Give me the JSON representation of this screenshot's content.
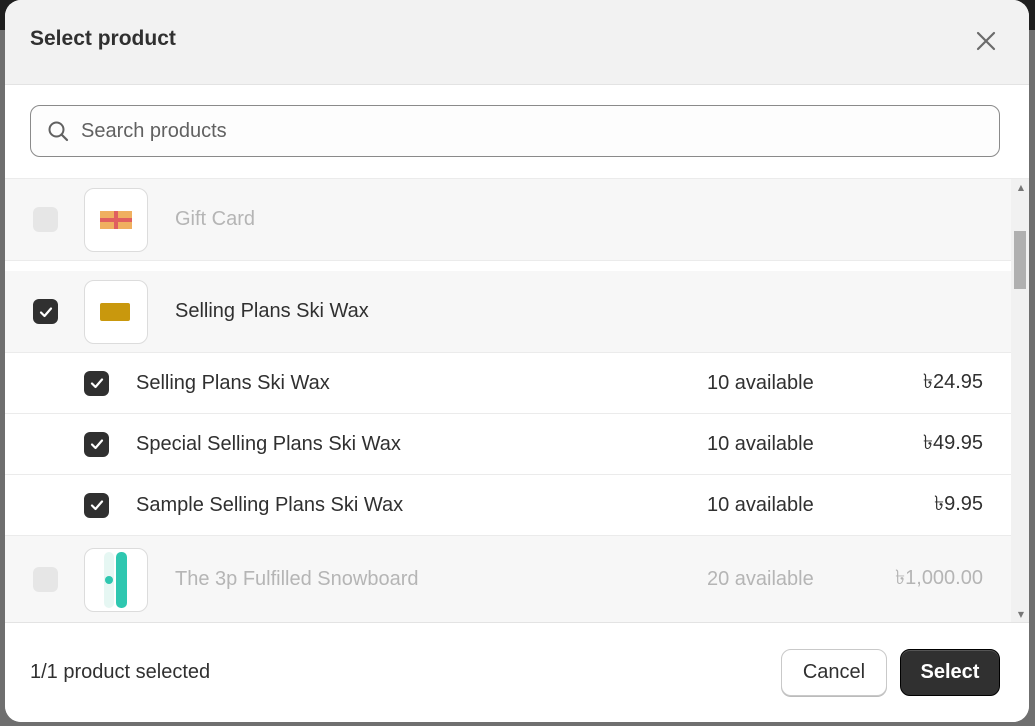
{
  "dialog": {
    "title": "Select product",
    "close_icon": "close-icon"
  },
  "search": {
    "placeholder": "Search products",
    "value": ""
  },
  "products": [
    {
      "name": "Gift Card",
      "checked": false,
      "disabled": true
    },
    {
      "name": "Selling Plans Ski Wax",
      "checked": true,
      "disabled": false,
      "variants": [
        {
          "name": "Selling Plans Ski Wax",
          "available": "10 available",
          "price": "৳24.95",
          "checked": true
        },
        {
          "name": "Special Selling Plans Ski Wax",
          "available": "10 available",
          "price": "৳49.95",
          "checked": true
        },
        {
          "name": "Sample Selling Plans Ski Wax",
          "available": "10 available",
          "price": "৳9.95",
          "checked": true
        }
      ]
    },
    {
      "name": "The 3p Fulfilled Snowboard",
      "available": "20 available",
      "price": "৳1,000.00",
      "checked": false,
      "disabled": true
    }
  ],
  "footer": {
    "status": "1/1 product selected",
    "cancel_label": "Cancel",
    "select_label": "Select"
  }
}
